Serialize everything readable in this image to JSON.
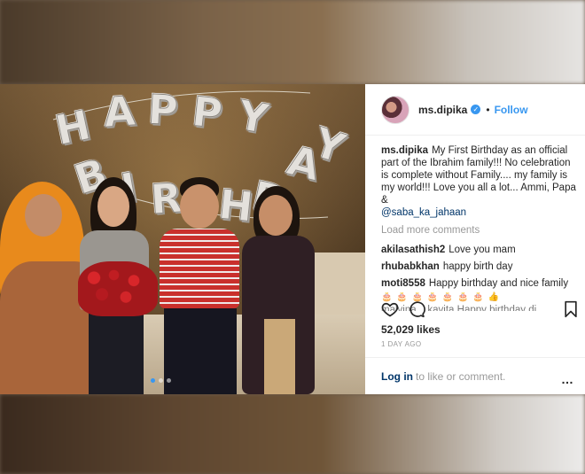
{
  "post": {
    "username": "ms.dipika",
    "separator": "•",
    "follow_label": "Follow",
    "caption_user": "ms.dipika",
    "caption_text": "My First Birthday as an official part of the Ibrahim family!!! No celebration is complete without Family.... my family is my world!!! Love you all a lot... Ammi, Papa &",
    "caption_mention": "@saba_ka_jahaan",
    "load_more": "Load more comments",
    "comments": [
      {
        "user": "akilasathish2",
        "text": "Love you mam"
      },
      {
        "user": "rhubabkhan",
        "text": "happy birth day"
      },
      {
        "user": "moti8558",
        "text": "Happy birthday and nice family"
      }
    ],
    "emoji_row": "🎂 🎂 🎂 🎂 🎂 🎂 🎂 👍",
    "clipped_comment": "malvina... kavita Happy birthday di",
    "likes": "52,029 likes",
    "timestamp": "1 DAY AGO",
    "login_link": "Log in",
    "login_text": "to like or comment.",
    "more_icon": "…"
  },
  "photo": {
    "balloon_letters": [
      "H",
      "A",
      "P",
      "P",
      "Y",
      "B",
      "I",
      "R",
      "T",
      "H",
      "D",
      "A",
      "Y"
    ]
  },
  "icons": {
    "heart": "heart-icon",
    "comment": "comment-bubble-icon",
    "bookmark": "bookmark-icon",
    "verified": "verified-badge-icon",
    "more": "more-options-icon"
  },
  "colors": {
    "link_blue": "#3897f0",
    "mention_blue": "#003569",
    "muted": "#999999"
  }
}
